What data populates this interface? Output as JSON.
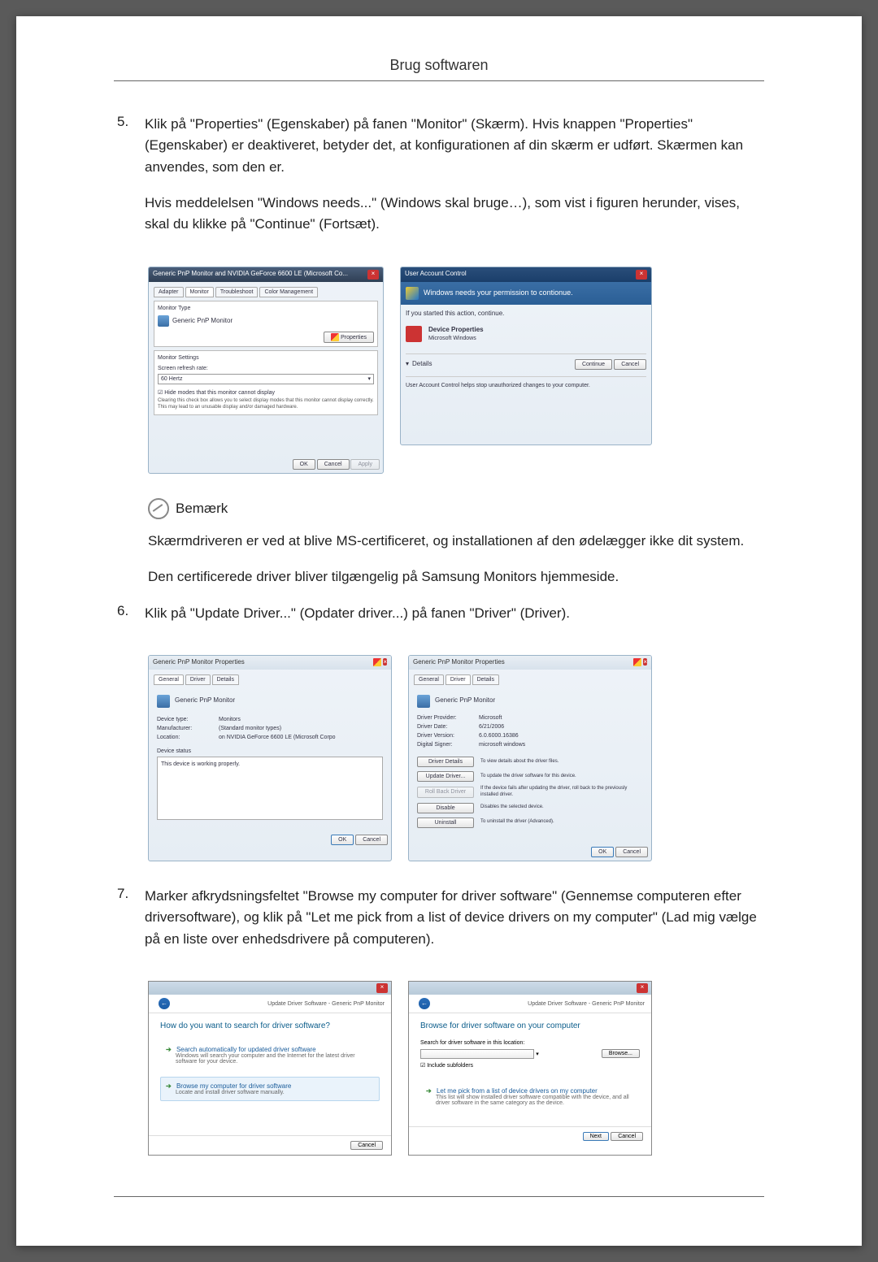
{
  "page_header": "Brug softwaren",
  "step5": {
    "num": "5.",
    "p1": "Klik på \"Properties\" (Egenskaber) på fanen \"Monitor\" (Skærm). Hvis knappen \"Properties\" (Egenskaber) er deaktiveret, betyder det, at konfigurationen af din skærm er udført. Skærmen kan anvendes, som den er.",
    "p2": "Hvis meddelelsen \"Windows needs...\" (Windows skal bruge…), som vist i figuren herunder, vises, skal du klikke på \"Continue\" (Fortsæt)."
  },
  "monitor_dialog": {
    "title": "Generic PnP Monitor and NVIDIA GeForce 6600 LE (Microsoft Co...",
    "tabs": [
      "Adapter",
      "Monitor",
      "Troubleshoot",
      "Color Management"
    ],
    "section_monitor_type": "Monitor Type",
    "monitor_name": "Generic PnP Monitor",
    "properties_btn": "Properties",
    "section_settings": "Monitor Settings",
    "refresh_label": "Screen refresh rate:",
    "refresh_value": "60 Hertz",
    "hide_modes_check": "Hide modes that this monitor cannot display",
    "hide_modes_desc": "Clearing this check box allows you to select display modes that this monitor cannot display correctly. This may lead to an unusable display and/or damaged hardware.",
    "ok": "OK",
    "cancel": "Cancel",
    "apply": "Apply"
  },
  "uac_dialog": {
    "title": "User Account Control",
    "banner": "Windows needs your permission to contionue.",
    "if_started": "If you started this action, continue.",
    "device_properties": "Device Properties",
    "ms_windows": "Microsoft Windows",
    "details": "Details",
    "continue_btn": "Continue",
    "cancel_btn": "Cancel",
    "footer_text": "User Account Control helps stop unauthorized changes to your computer."
  },
  "note": {
    "title": "Bemærk",
    "p1": "Skærmdriveren er ved at blive MS-certificeret, og installationen af den ødelægger ikke dit system.",
    "p2": "Den certificerede driver bliver tilgængelig på Samsung Monitors hjemmeside."
  },
  "step6": {
    "num": "6.",
    "p1": "Klik på \"Update Driver...\" (Opdater driver...) på fanen \"Driver\" (Driver)."
  },
  "props_general": {
    "title": "Generic PnP Monitor Properties",
    "tabs": [
      "General",
      "Driver",
      "Details"
    ],
    "name_label": "Generic PnP Monitor",
    "device_type_lbl": "Device type:",
    "device_type_val": "Monitors",
    "manufacturer_lbl": "Manufacturer:",
    "manufacturer_val": "(Standard monitor types)",
    "location_lbl": "Location:",
    "location_val": "on NVIDIA GeForce 6600 LE (Microsoft Corpo",
    "status_lbl": "Device status",
    "status_text": "This device is working properly.",
    "ok": "OK",
    "cancel": "Cancel"
  },
  "props_driver": {
    "title": "Generic PnP Monitor Properties",
    "tabs": [
      "General",
      "Driver",
      "Details"
    ],
    "name_label": "Generic PnP Monitor",
    "provider_lbl": "Driver Provider:",
    "provider_val": "Microsoft",
    "date_lbl": "Driver Date:",
    "date_val": "6/21/2006",
    "version_lbl": "Driver Version:",
    "version_val": "6.0.6000.16386",
    "signer_lbl": "Digital Signer:",
    "signer_val": "microsoft windows",
    "btn_details": "Driver Details",
    "desc_details": "To view details about the driver files.",
    "btn_update": "Update Driver...",
    "desc_update": "To update the driver software for this device.",
    "btn_rollback": "Roll Back Driver",
    "desc_rollback": "If the device fails after updating the driver, roll back to the previously installed driver.",
    "btn_disable": "Disable",
    "desc_disable": "Disables the selected device.",
    "btn_uninstall": "Uninstall",
    "desc_uninstall": "To uninstall the driver (Advanced).",
    "ok": "OK",
    "cancel": "Cancel"
  },
  "step7": {
    "num": "7.",
    "p1": "Marker afkrydsningsfeltet \"Browse my computer for driver software\" (Gennemse computeren efter driversoftware), og klik på \"Let me pick from a list of device drivers on my computer\" (Lad mig vælge på en liste over enhedsdrivere på computeren)."
  },
  "wizard1": {
    "breadcrumb": "Update Driver Software - Generic PnP Monitor",
    "heading": "How do you want to search for driver software?",
    "opt1_title": "Search automatically for updated driver software",
    "opt1_desc": "Windows will search your computer and the Internet for the latest driver software for your device.",
    "opt2_title": "Browse my computer for driver software",
    "opt2_desc": "Locate and install driver software manually.",
    "cancel": "Cancel"
  },
  "wizard2": {
    "breadcrumb": "Update Driver Software - Generic PnP Monitor",
    "heading": "Browse for driver software on your computer",
    "search_label": "Search for driver software in this location:",
    "browse_btn": "Browse...",
    "subfolders": "Include subfolders",
    "opt_title": "Let me pick from a list of device drivers on my computer",
    "opt_desc": "This list will show installed driver software compatible with the device, and all driver software in the same category as the device.",
    "next": "Next",
    "cancel": "Cancel"
  }
}
